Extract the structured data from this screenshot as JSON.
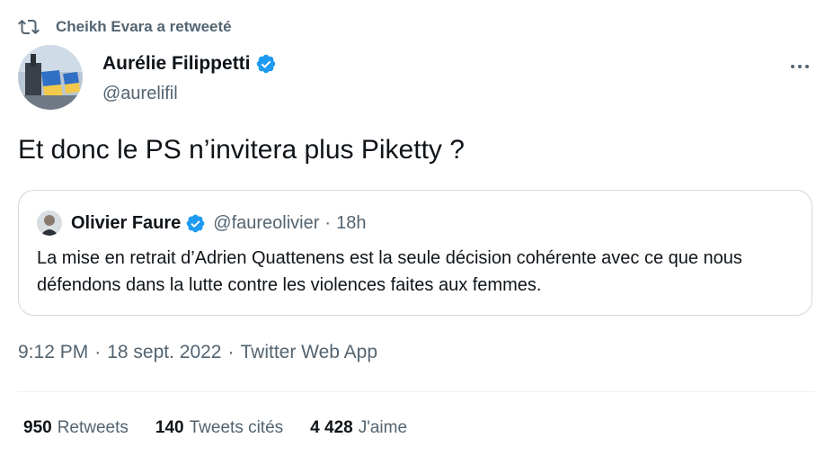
{
  "retweet_context": {
    "text": "Cheikh Evara a retweeté"
  },
  "author": {
    "name": "Aurélie Filippetti",
    "handle": "@aurelifil"
  },
  "tweet": {
    "text": "Et donc le PS n’invitera plus Piketty ?"
  },
  "quoted_tweet": {
    "author_name": "Olivier Faure",
    "handle": "@faureolivier",
    "separator": "·",
    "time": "18h",
    "text": "La mise en retrait d’Adrien Quattenens est la seule décision cohérente avec ce que nous défendons dans la lutte contre les violences faites aux femmes."
  },
  "meta": {
    "time": "9:12 PM",
    "separator": "·",
    "date": "18 sept. 2022",
    "source": "Twitter Web App"
  },
  "stats": {
    "retweets": {
      "count": "950",
      "label": "Retweets"
    },
    "quotes": {
      "count": "140",
      "label": "Tweets cités"
    },
    "likes": {
      "count": "4 428",
      "label": "J'aime"
    }
  },
  "colors": {
    "verified": "#1d9bf0",
    "secondary_text": "#536471",
    "primary_text": "#0f1419",
    "border": "#cfd9de"
  },
  "icons": {
    "retweet": "retweet-icon",
    "verified": "verified-badge-icon",
    "more": "more-options-icon"
  }
}
